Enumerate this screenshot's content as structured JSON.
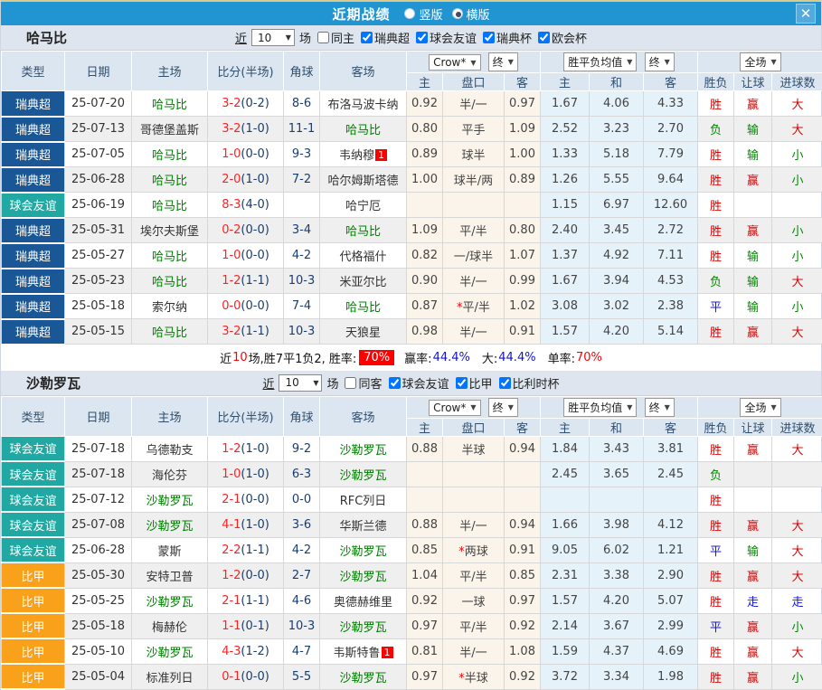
{
  "topbar": {
    "title": "近期战绩",
    "radio_vertical": "竖版",
    "radio_horizontal": "横版",
    "selected": "横版",
    "close_icon": "✕"
  },
  "table_header": {
    "cols": [
      "类型",
      "日期",
      "主场",
      "比分(半场)",
      "角球",
      "客场"
    ],
    "crow_dropdown": "Crow*",
    "end_dropdown_1": "终",
    "avg_dropdown": "胜平负均值",
    "end_dropdown_2": "终",
    "full_dropdown": "全场",
    "sub": [
      "主",
      "盘口",
      "客",
      "主",
      "和",
      "客",
      "胜负",
      "让球",
      "进球数"
    ]
  },
  "sections": [
    {
      "team": "哈马比",
      "filter": {
        "near": "近",
        "count": "10",
        "unit": "场",
        "same_label": "同主",
        "same_checked": false,
        "leagues": [
          {
            "label": "瑞典超",
            "checked": true
          },
          {
            "label": "球会友谊",
            "checked": true
          },
          {
            "label": "瑞典杯",
            "checked": true
          },
          {
            "label": "欧会杯",
            "checked": true
          }
        ]
      },
      "rows": [
        {
          "type": "瑞典超",
          "date": "25-07-20",
          "home": "哈马比",
          "hg": true,
          "score": "3-2",
          "half": "(0-2)",
          "corner": "8-6",
          "away": "布洛马波卡纳",
          "ag": false,
          "ab": "",
          "o1": "0.92",
          "hcp": "半/一",
          "o2": "0.97",
          "m1": "1.67",
          "m2": "4.06",
          "m3": "4.33",
          "r1": "胜",
          "r2": "赢",
          "r3": "大"
        },
        {
          "type": "瑞典超",
          "date": "25-07-13",
          "home": "哥德堡盖斯",
          "hg": false,
          "score": "3-2",
          "half": "(1-0)",
          "corner": "11-1",
          "away": "哈马比",
          "ag": true,
          "ab": "",
          "o1": "0.80",
          "hcp": "平手",
          "o2": "1.09",
          "m1": "2.52",
          "m2": "3.23",
          "m3": "2.70",
          "r1": "负",
          "r2": "输",
          "r3": "大"
        },
        {
          "type": "瑞典超",
          "date": "25-07-05",
          "home": "哈马比",
          "hg": true,
          "score": "1-0",
          "half": "(0-0)",
          "corner": "9-3",
          "away": "韦纳穆",
          "ag": false,
          "ab": "1",
          "o1": "0.89",
          "hcp": "球半",
          "o2": "1.00",
          "m1": "1.33",
          "m2": "5.18",
          "m3": "7.79",
          "r1": "胜",
          "r2": "输",
          "r3": "小"
        },
        {
          "type": "瑞典超",
          "date": "25-06-28",
          "home": "哈马比",
          "hg": true,
          "score": "2-0",
          "half": "(1-0)",
          "corner": "7-2",
          "away": "哈尔姆斯塔德",
          "ag": false,
          "ab": "",
          "o1": "1.00",
          "hcp": "球半/两",
          "o2": "0.89",
          "m1": "1.26",
          "m2": "5.55",
          "m3": "9.64",
          "r1": "胜",
          "r2": "赢",
          "r3": "小"
        },
        {
          "type": "球会友谊",
          "date": "25-06-19",
          "home": "哈马比",
          "hg": true,
          "score": "8-3",
          "half": "(4-0)",
          "corner": "",
          "away": "哈宁厄",
          "ag": false,
          "ab": "",
          "o1": "",
          "hcp": "",
          "o2": "",
          "m1": "1.15",
          "m2": "6.97",
          "m3": "12.60",
          "r1": "胜",
          "r2": "",
          "r3": ""
        },
        {
          "type": "瑞典超",
          "date": "25-05-31",
          "home": "埃尔夫斯堡",
          "hg": false,
          "score": "0-2",
          "half": "(0-0)",
          "corner": "3-4",
          "away": "哈马比",
          "ag": true,
          "ab": "",
          "o1": "1.09",
          "hcp": "平/半",
          "o2": "0.80",
          "m1": "2.40",
          "m2": "3.45",
          "m3": "2.72",
          "r1": "胜",
          "r2": "赢",
          "r3": "小"
        },
        {
          "type": "瑞典超",
          "date": "25-05-27",
          "home": "哈马比",
          "hg": true,
          "score": "1-0",
          "half": "(0-0)",
          "corner": "4-2",
          "away": "代格福什",
          "ag": false,
          "ab": "",
          "o1": "0.82",
          "hcp": "一/球半",
          "o2": "1.07",
          "m1": "1.37",
          "m2": "4.92",
          "m3": "7.11",
          "r1": "胜",
          "r2": "输",
          "r3": "小"
        },
        {
          "type": "瑞典超",
          "date": "25-05-23",
          "home": "哈马比",
          "hg": true,
          "score": "1-2",
          "half": "(1-1)",
          "corner": "10-3",
          "away": "米亚尔比",
          "ag": false,
          "ab": "",
          "o1": "0.90",
          "hcp": "半/一",
          "o2": "0.99",
          "m1": "1.67",
          "m2": "3.94",
          "m3": "4.53",
          "r1": "负",
          "r2": "输",
          "r3": "大"
        },
        {
          "type": "瑞典超",
          "date": "25-05-18",
          "home": "索尔纳",
          "hg": false,
          "score": "0-0",
          "half": "(0-0)",
          "corner": "7-4",
          "away": "哈马比",
          "ag": true,
          "ab": "",
          "o1": "0.87",
          "hcp": "*平/半",
          "o2": "1.02",
          "m1": "3.08",
          "m2": "3.02",
          "m3": "2.38",
          "r1": "平",
          "r2": "输",
          "r3": "小"
        },
        {
          "type": "瑞典超",
          "date": "25-05-15",
          "home": "哈马比",
          "hg": true,
          "score": "3-2",
          "half": "(1-1)",
          "corner": "10-3",
          "away": "天狼星",
          "ag": false,
          "ab": "",
          "o1": "0.98",
          "hcp": "半/一",
          "o2": "0.91",
          "m1": "1.57",
          "m2": "4.20",
          "m3": "5.14",
          "r1": "胜",
          "r2": "赢",
          "r3": "大"
        }
      ],
      "summary": {
        "pre": "近",
        "num": "10",
        "mid": "场,胜7平1负2, 胜率:",
        "badge": "70%",
        "l1": "赢率:",
        "v1": "44.4%",
        "l2": "大:",
        "v2": "44.4%",
        "l3": "单率:",
        "v3": "70%"
      }
    },
    {
      "team": "沙勒罗瓦",
      "filter": {
        "near": "近",
        "count": "10",
        "unit": "场",
        "same_label": "同客",
        "same_checked": false,
        "leagues": [
          {
            "label": "球会友谊",
            "checked": true
          },
          {
            "label": "比甲",
            "checked": true
          },
          {
            "label": "比利时杯",
            "checked": true
          }
        ]
      },
      "rows": [
        {
          "type": "球会友谊",
          "date": "25-07-18",
          "home": "乌德勒支",
          "hg": false,
          "score": "1-2",
          "half": "(1-0)",
          "corner": "9-2",
          "away": "沙勒罗瓦",
          "ag": true,
          "ab": "",
          "o1": "0.88",
          "hcp": "半球",
          "o2": "0.94",
          "m1": "1.84",
          "m2": "3.43",
          "m3": "3.81",
          "r1": "胜",
          "r2": "赢",
          "r3": "大"
        },
        {
          "type": "球会友谊",
          "date": "25-07-18",
          "home": "海伦芬",
          "hg": false,
          "score": "1-0",
          "half": "(1-0)",
          "corner": "6-3",
          "away": "沙勒罗瓦",
          "ag": true,
          "ab": "",
          "o1": "",
          "hcp": "",
          "o2": "",
          "m1": "2.45",
          "m2": "3.65",
          "m3": "2.45",
          "r1": "负",
          "r2": "",
          "r3": ""
        },
        {
          "type": "球会友谊",
          "date": "25-07-12",
          "home": "沙勒罗瓦",
          "hg": true,
          "score": "2-1",
          "half": "(0-0)",
          "corner": "0-0",
          "away": "RFC列日",
          "ag": false,
          "ab": "",
          "o1": "",
          "hcp": "",
          "o2": "",
          "m1": "",
          "m2": "",
          "m3": "",
          "r1": "胜",
          "r2": "",
          "r3": ""
        },
        {
          "type": "球会友谊",
          "date": "25-07-08",
          "home": "沙勒罗瓦",
          "hg": true,
          "score": "4-1",
          "half": "(1-0)",
          "corner": "3-6",
          "away": "华斯兰德",
          "ag": false,
          "ab": "",
          "o1": "0.88",
          "hcp": "半/一",
          "o2": "0.94",
          "m1": "1.66",
          "m2": "3.98",
          "m3": "4.12",
          "r1": "胜",
          "r2": "赢",
          "r3": "大"
        },
        {
          "type": "球会友谊",
          "date": "25-06-28",
          "home": "蒙斯",
          "hg": false,
          "score": "2-2",
          "half": "(1-1)",
          "corner": "4-2",
          "away": "沙勒罗瓦",
          "ag": true,
          "ab": "",
          "o1": "0.85",
          "hcp": "*两球",
          "o2": "0.91",
          "m1": "9.05",
          "m2": "6.02",
          "m3": "1.21",
          "r1": "平",
          "r2": "输",
          "r3": "大"
        },
        {
          "type": "比甲",
          "date": "25-05-30",
          "home": "安特卫普",
          "hg": false,
          "score": "1-2",
          "half": "(0-0)",
          "corner": "2-7",
          "away": "沙勒罗瓦",
          "ag": true,
          "ab": "",
          "o1": "1.04",
          "hcp": "平/半",
          "o2": "0.85",
          "m1": "2.31",
          "m2": "3.38",
          "m3": "2.90",
          "r1": "胜",
          "r2": "赢",
          "r3": "大"
        },
        {
          "type": "比甲",
          "date": "25-05-25",
          "home": "沙勒罗瓦",
          "hg": true,
          "score": "2-1",
          "half": "(1-1)",
          "corner": "4-6",
          "away": "奥德赫维里",
          "ag": false,
          "ab": "",
          "o1": "0.92",
          "hcp": "一球",
          "o2": "0.97",
          "m1": "1.57",
          "m2": "4.20",
          "m3": "5.07",
          "r1": "胜",
          "r2": "走",
          "r3": "走"
        },
        {
          "type": "比甲",
          "date": "25-05-18",
          "home": "梅赫伦",
          "hg": false,
          "score": "1-1",
          "half": "(0-1)",
          "corner": "10-3",
          "away": "沙勒罗瓦",
          "ag": true,
          "ab": "",
          "o1": "0.97",
          "hcp": "平/半",
          "o2": "0.92",
          "m1": "2.14",
          "m2": "3.67",
          "m3": "2.99",
          "r1": "平",
          "r2": "赢",
          "r3": "小"
        },
        {
          "type": "比甲",
          "date": "25-05-10",
          "home": "沙勒罗瓦",
          "hg": true,
          "score": "4-3",
          "half": "(1-2)",
          "corner": "4-7",
          "away": "韦斯特鲁",
          "ag": false,
          "ab": "1",
          "o1": "0.81",
          "hcp": "半/一",
          "o2": "1.08",
          "m1": "1.59",
          "m2": "4.37",
          "m3": "4.69",
          "r1": "胜",
          "r2": "赢",
          "r3": "大"
        },
        {
          "type": "比甲",
          "date": "25-05-04",
          "home": "标准列日",
          "hg": false,
          "score": "0-1",
          "half": "(0-0)",
          "corner": "5-5",
          "away": "沙勒罗瓦",
          "ag": true,
          "ab": "",
          "o1": "0.97",
          "hcp": "*半球",
          "o2": "0.92",
          "m1": "3.72",
          "m2": "3.34",
          "m3": "1.98",
          "r1": "胜",
          "r2": "赢",
          "r3": "小"
        }
      ],
      "summary": null
    }
  ],
  "colors": {
    "topbar_blue": "#2095D2",
    "top_accent_tan": "#D9CA8E",
    "header_bg": "#DCE6F0",
    "section_bg": "#DEE5EE",
    "stripe_gray": "#EFEFEF",
    "cream_col": "#FAF4EA",
    "lightblue_col": "#E5F2F9",
    "focus_team_green": "#008000",
    "score_red": "#FF2222",
    "halftime_navy": "#1B3D6D",
    "result_red": "#DD0000",
    "result_green": "#008800",
    "result_blue": "#1414E6",
    "rate_badge_red": "#FF0000",
    "rate_value_blue": "#1414CC",
    "league_colors": {
      "瑞典超": "#1A5796",
      "球会友谊": "#21A8A2",
      "比甲": "#F9A11B"
    }
  }
}
